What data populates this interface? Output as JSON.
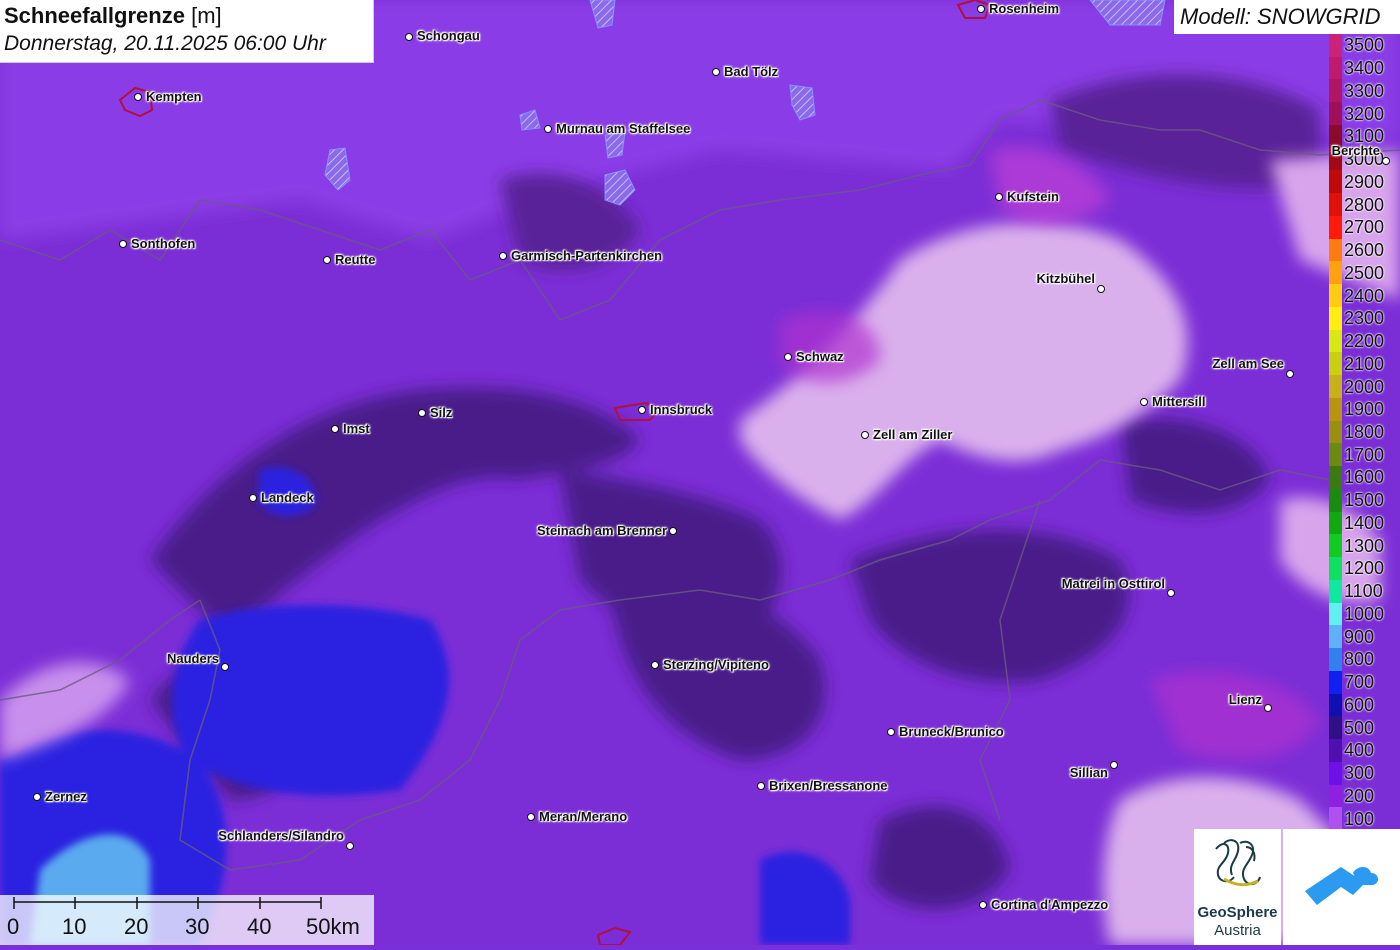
{
  "header": {
    "title_bold": "Schneefallgrenze",
    "title_unit": "[m]",
    "datetime": "Donnerstag, 20.11.2025 06:00 Uhr"
  },
  "model": {
    "label": "Modell: SNOWGRID"
  },
  "legend": {
    "items": [
      {
        "label": "3500",
        "color": "#cc2277"
      },
      {
        "label": "3400",
        "color": "#c01a6e"
      },
      {
        "label": "3300",
        "color": "#b01664"
      },
      {
        "label": "3200",
        "color": "#a0105a"
      },
      {
        "label": "3100",
        "color": "#8c0a2a"
      },
      {
        "label": "3000",
        "color": "#a00a14"
      },
      {
        "label": "2900",
        "color": "#c00a0a"
      },
      {
        "label": "2800",
        "color": "#e0100a"
      },
      {
        "label": "2700",
        "color": "#ff1a0a"
      },
      {
        "label": "2600",
        "color": "#ff7a10"
      },
      {
        "label": "2500",
        "color": "#ffa010"
      },
      {
        "label": "2400",
        "color": "#ffcc10"
      },
      {
        "label": "2300",
        "color": "#ffee10"
      },
      {
        "label": "2200",
        "color": "#d8e810"
      },
      {
        "label": "2100",
        "color": "#c8d010"
      },
      {
        "label": "2000",
        "color": "#c8b018"
      },
      {
        "label": "1900",
        "color": "#b89410"
      },
      {
        "label": "1800",
        "color": "#9a9010"
      },
      {
        "label": "1700",
        "color": "#6a8a10"
      },
      {
        "label": "1600",
        "color": "#3a7a10"
      },
      {
        "label": "1500",
        "color": "#1a8a10"
      },
      {
        "label": "1400",
        "color": "#10aa10"
      },
      {
        "label": "1300",
        "color": "#10cc20"
      },
      {
        "label": "1200",
        "color": "#10e060"
      },
      {
        "label": "1100",
        "color": "#10e8a0"
      },
      {
        "label": "1000",
        "color": "#60f0f0"
      },
      {
        "label": "900",
        "color": "#60b0f8"
      },
      {
        "label": "800",
        "color": "#3080f0"
      },
      {
        "label": "700",
        "color": "#1020f0"
      },
      {
        "label": "600",
        "color": "#1010b0"
      },
      {
        "label": "500",
        "color": "#301088"
      },
      {
        "label": "400",
        "color": "#5010b0"
      },
      {
        "label": "300",
        "color": "#7010e8"
      },
      {
        "label": "200",
        "color": "#9020e0"
      },
      {
        "label": "100",
        "color": "#b050f0"
      }
    ]
  },
  "scalebar": {
    "labels": [
      "0",
      "10",
      "20",
      "30",
      "40",
      "50km"
    ]
  },
  "logos": {
    "org_name": "GeoSphere",
    "org_sub": "Austria"
  },
  "cities": [
    {
      "name": "Schongau"
    },
    {
      "name": "Rosenheim"
    },
    {
      "name": "Kempten"
    },
    {
      "name": "Bad Tölz"
    },
    {
      "name": "Murnau am Staffelsee"
    },
    {
      "name": "Berchte"
    },
    {
      "name": "Kufstein"
    },
    {
      "name": "Sonthofen"
    },
    {
      "name": "Reutte"
    },
    {
      "name": "Garmisch-Partenkirchen"
    },
    {
      "name": "Kitzbühel"
    },
    {
      "name": "Schwaz"
    },
    {
      "name": "Zell am See"
    },
    {
      "name": "Imst"
    },
    {
      "name": "Silz"
    },
    {
      "name": "Innsbruck"
    },
    {
      "name": "Mittersill"
    },
    {
      "name": "Zell am Ziller"
    },
    {
      "name": "Landeck"
    },
    {
      "name": "Steinach am Brenner"
    },
    {
      "name": "Matrei in Osttirol"
    },
    {
      "name": "Nauders"
    },
    {
      "name": "Sterzing/Vipiteno"
    },
    {
      "name": "Lienz"
    },
    {
      "name": "Bruneck/Brunico"
    },
    {
      "name": "Sillian"
    },
    {
      "name": "Brixen/Bressanone"
    },
    {
      "name": "Zernez"
    },
    {
      "name": "Meran/Merano"
    },
    {
      "name": "Schlanders/Silandro"
    },
    {
      "name": "Cortina d'Ampezzo"
    }
  ]
}
